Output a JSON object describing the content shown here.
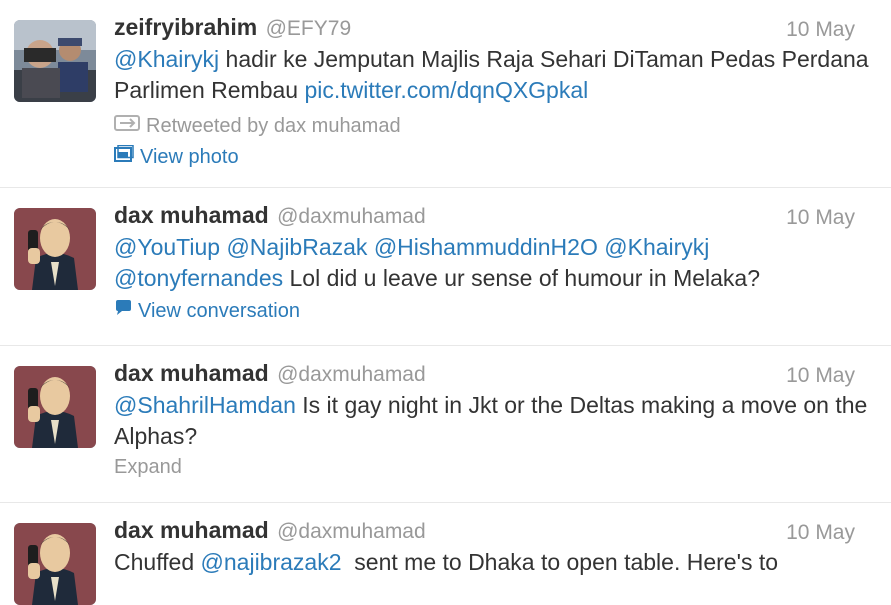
{
  "tweets": [
    {
      "name": "zeifryibrahim",
      "handle": "@EFY79",
      "time": "10 May",
      "mention": "@Khairykj",
      "text_a": " hadir ke Jemputan Majlis Raja Sehari DiTaman Pedas Perdana Parlimen Rembau ",
      "link": "pic.twitter.com/dqnQXGpkal",
      "retweeted_by": "Retweeted by dax muhamad",
      "action": "View photo"
    },
    {
      "name": "dax muhamad",
      "handle": "@daxmuhamad",
      "time": "10 May",
      "mentions": [
        "@YouTiup",
        "@NajibRazak",
        "@HishammuddinH2O",
        "@Khairykj",
        "@tonyfernandes"
      ],
      "text_a": " Lol did u leave ur sense of humour in Melaka?",
      "action": "View conversation"
    },
    {
      "name": "dax muhamad",
      "handle": "@daxmuhamad",
      "time": "10 May",
      "mention": "@ShahrilHamdan",
      "text_a": " Is it gay night in Jkt or the Deltas making a move on the Alphas?",
      "action": "Expand"
    },
    {
      "name": "dax muhamad",
      "handle": "@daxmuhamad",
      "time": "10 May",
      "text_pre": "Chuffed ",
      "mention": "@najibrazak2",
      "text_a": "  sent me to Dhaka to open table. Here's to"
    }
  ],
  "icons": {
    "retweet": "retweet-icon",
    "photo": "photo-icon",
    "conversation": "conversation-icon"
  },
  "colors": {
    "link": "#2b7bb9",
    "muted": "#999999",
    "text": "#333333"
  }
}
